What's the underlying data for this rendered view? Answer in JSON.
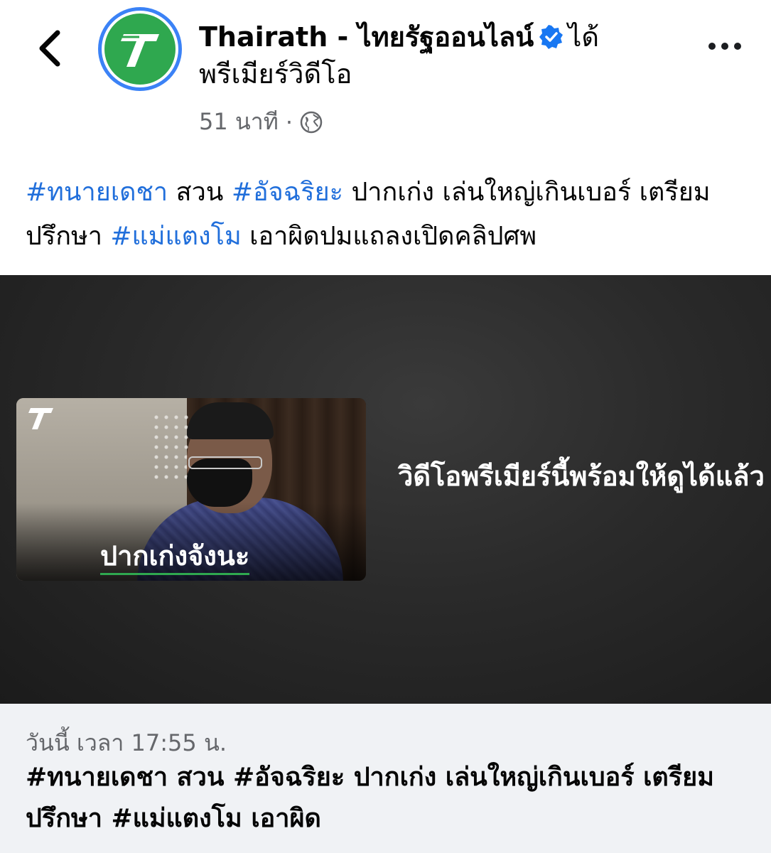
{
  "header": {
    "page_name": "Thairath - ไทยรัฐออนไลน์",
    "action_text": "ได้พรีเมียร์วิดีโอ",
    "time_ago": "51 นาที",
    "separator": "·"
  },
  "caption": {
    "segments": [
      {
        "text": "#ทนายเดชา",
        "type": "hashtag"
      },
      {
        "text": " สวน ",
        "type": "text"
      },
      {
        "text": "#อัจฉริยะ",
        "type": "hashtag"
      },
      {
        "text": " ปากเก่ง เล่นใหญ่เกินเบอร์ เตรียมปรึกษา ",
        "type": "text"
      },
      {
        "text": "#แม่แตงโม",
        "type": "hashtag"
      },
      {
        "text": " เอาผิดปมแถลงเปิดคลิปศพ",
        "type": "text"
      }
    ]
  },
  "video": {
    "thumbnail_caption": "ปากเก่งจังนะ",
    "premiere_message": "วิดีโอพรีเมียร์นี้พร้อมให้ดูได้แล้ว"
  },
  "info": {
    "date_line": "วันนี้ เวลา 17:55 น.",
    "title": "#ทนายเดชา สวน #อัจฉริยะ ปากเก่ง เล่นใหญ่เกินเบอร์ เตรียมปรึกษา #แม่แตงโม เอาผิด"
  },
  "colors": {
    "hashtag": "#216fdb",
    "brand_green": "#2fa84f",
    "verified_blue": "#1877f2",
    "muted_text": "#65676b",
    "info_bg": "#f0f2f5"
  },
  "icons": [
    "back-arrow-icon",
    "verified-badge-icon",
    "globe-icon",
    "more-options-icon",
    "thairath-logo-icon"
  ]
}
